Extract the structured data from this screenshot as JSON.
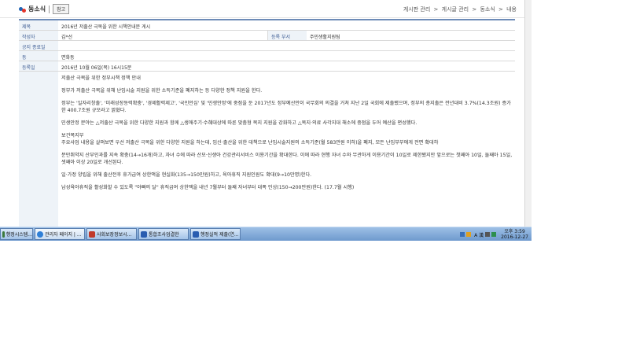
{
  "header": {
    "logo_text": "동소식",
    "help_label": "참고",
    "breadcrumb": [
      "게시판 관리",
      "게시글 관리",
      "동소식",
      "내용"
    ],
    "breadcrumb_sep": ">"
  },
  "form": {
    "title_label": "제목",
    "title_value": "2016년 저출산 극복을 위한 시책안내문 게시",
    "author_label": "작성자",
    "author_value": "김*선",
    "dept_label": "등록 부서",
    "dept_value": "주민생활지원팀",
    "public_label": "공지 종료일",
    "public_value": "",
    "dong_label": "동",
    "dong_value": "면화동",
    "date_label": "등록일",
    "date_value": "2016년 10월 06일(목) 16시15분"
  },
  "content": [
    "저출산 극복을 위한 정부시책 정책 안내",
    "정부가 저출산 극복을 위해 난임시술 지원을 위한 소득기준을 폐지하는 등 다양한 정책 지원을 한다.",
    "정부는 '일자리창출', '미래성장동력확충', '경제활력제고', '국민안심' 및 '민생안정'에 중점을 둔 2017년도 정부예산안이 국무회의 의결을 거쳐 지난 2일 국회에 제출됐으며, 정부의 총지출은 전년대비 3.7%(14.3조원) 증가한 400.7조원 규모라고 밝혔다.",
    "민생안정 분야는 △저출산 극복을 위한 다양한 지원과 함께 △생애주기·수혜대상에 따른 맞춤형 복지 지원을 강화하고 △복지·의료 사각지대 해소에 중점을 두어 예산을 편성했다.",
    "보건복지부",
    "주요사업 내용을 살펴보면 우선 저출산 극복을 위한 다양한 지원을 하는데, 임신·출산을 위한 대책으로 난임시술지원의 소득기준(월 583만원 이하)을 폐지, 모든 난임부부에게 전면 확대하",
    "분만취약지 산부인과를 지속 확충(14→16개)하고, 자녀 수에 따라 산모·신생아 건강관리서비스 이용기간을 확대한다. 이에 따라 현행 자녀 수와 무관하게 이용기간이 10일로 제한됐지만 앞으로는 첫째아 10일, 둘째아 15일, 셋째아 이상 20일로 개선된다.",
    "일·가정 양립을 위해 출산전후 휴가급여 상한액을 현실화(135→150만원)하고, 육아휴직 지원인원도 확대(9→10만명)한다.",
    "남성육아휴직을 활성화할 수 있도록 \"아빠의 달\" 휴직급여 상한액을 내년 7월부터 둘째 자녀부터 대폭 인상(150→200만원)한다. (17.7월 시행)"
  ],
  "taskbar": {
    "tasks": [
      {
        "label": "행정시스템..."
      },
      {
        "label": "관리자 페이지 | ..."
      },
      {
        "label": "사회보장정보시..."
      },
      {
        "label": "통합조사업결한"
      },
      {
        "label": "행정실적 제출(연..."
      }
    ],
    "tray_text": "A 漢",
    "clock_time": "오후 3:59",
    "clock_date": "2016-12-27"
  },
  "colors": {
    "accent": "#3e5d94",
    "form_border": "#6d8bb7",
    "taskbar": "#7aa2d4"
  }
}
